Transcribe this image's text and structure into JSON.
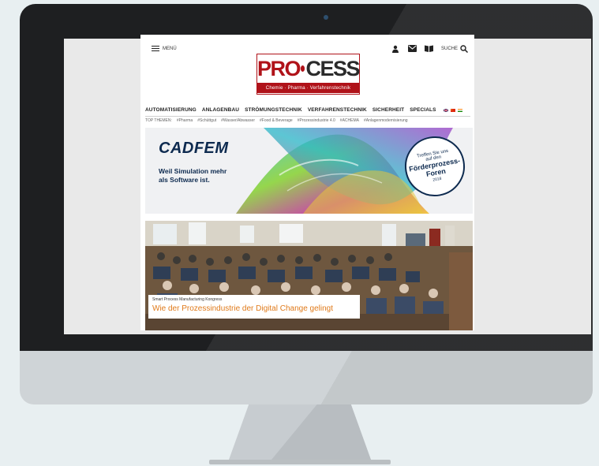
{
  "site": {
    "menu_label": "MENÜ",
    "search_label": "SUCHE",
    "logo": {
      "part1": "PRO",
      "part2": "CESS",
      "subtitle": "Chemie · Pharma · Verfahrenstechnik"
    },
    "nav": {
      "items": [
        "AUTOMATISIERUNG",
        "ANLAGENBAU",
        "STRÖMUNGSTECHNIK",
        "VERFAHRENSTECHNIK",
        "SICHERHEIT",
        "SPECIALS"
      ]
    },
    "topics": {
      "label": "TOP THEMEN:",
      "items": [
        "#Pharma",
        "#Schüttgut",
        "#Wasser/Abwasser",
        "#Food & Beverage",
        "#Prozessindustrie 4.0",
        "#ACHEMA",
        "#Anlagenmodernisierung"
      ]
    },
    "ad": {
      "brand": "CADFEM",
      "tagline_line1": "Weil Simulation mehr",
      "tagline_line2": "als Software ist.",
      "badge_line1": "Treffen Sie uns",
      "badge_line2": "auf den",
      "badge_line3": "Förderprozess-",
      "badge_line4": "Foren",
      "badge_line5": "2018"
    },
    "hero": {
      "kicker": "Smart Process Manufacturing Kongress",
      "title": "Wie der Prozessindustrie der Digital Change gelingt"
    }
  },
  "colors": {
    "brand_red": "#b01219",
    "headline_orange": "#e07a1a",
    "ad_navy": "#0d2a4f",
    "bezel": "#1e1f21"
  }
}
